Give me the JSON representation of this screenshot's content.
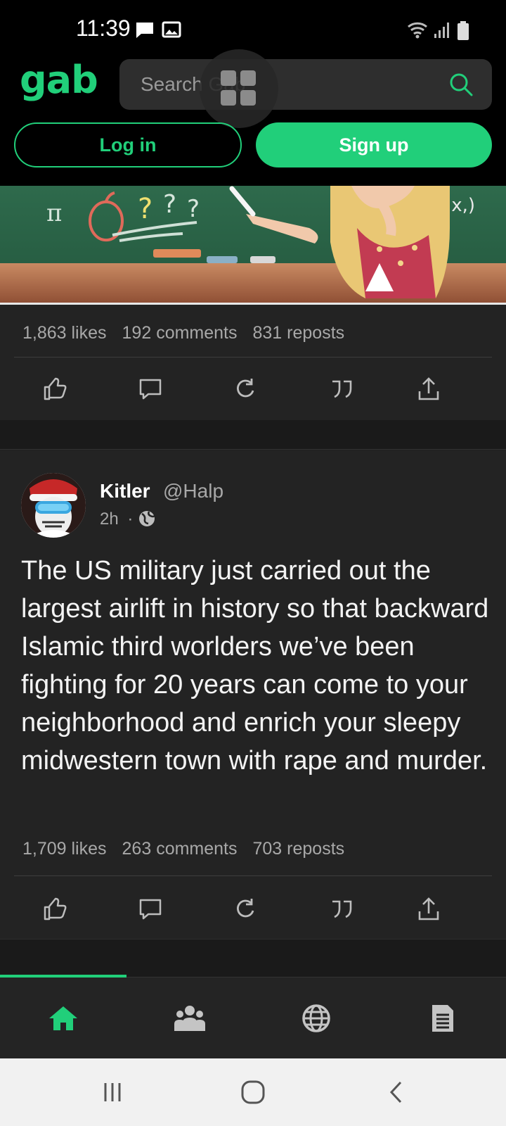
{
  "status_bar": {
    "time": "11:39"
  },
  "header": {
    "logo": "gab",
    "search_placeholder": "Search Gab",
    "login_label": "Log in",
    "signup_label": "Sign up",
    "accent": "#21cf7a"
  },
  "post1": {
    "likes": "1,863 likes",
    "comments": "192 comments",
    "reposts": "831 reposts"
  },
  "post2": {
    "author_name": "Kitler",
    "author_handle": "@Halp",
    "time": "2h",
    "separator": "·",
    "text": "The US military just carried out the largest airlift in history so that backward Islamic third worlders we’ve been fighting for 20 years can come to your neighborhood and enrich your sleepy midwestern town with rape and murder.",
    "likes": "1,709 likes",
    "comments": "263 comments",
    "reposts": "703 reposts"
  },
  "actions": [
    "like-icon",
    "comment-icon",
    "repost-icon",
    "quote-icon",
    "share-icon"
  ],
  "bottom_nav": [
    "home-icon",
    "groups-icon",
    "explore-icon",
    "news-icon"
  ],
  "system_nav": [
    "recents-icon",
    "home-button-icon",
    "back-icon"
  ]
}
